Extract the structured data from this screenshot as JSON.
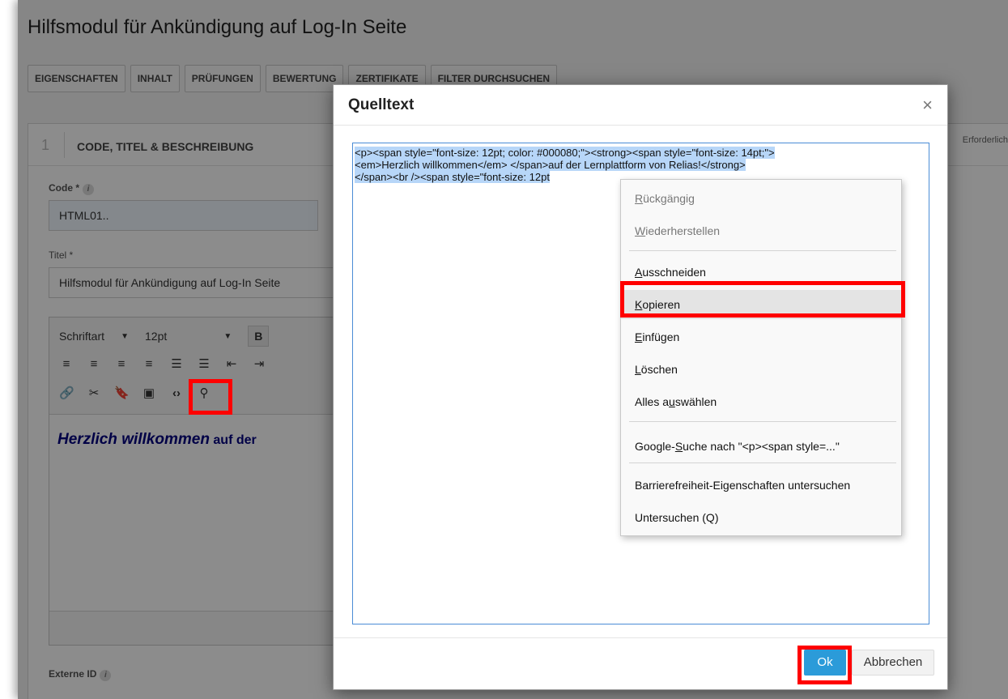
{
  "page": {
    "title": "Hilfsmodul für Ankündigung auf Log-In Seite",
    "tabs": [
      "EIGENSCHAFTEN",
      "INHALT",
      "PRÜFUNGEN",
      "BEWERTUNG",
      "ZERTIFIKATE",
      "FILTER DURCHSUCHEN"
    ],
    "section": {
      "number": "1",
      "title": "CODE, TITEL & BESCHREIBUNG",
      "required_note": "Erforderlich"
    },
    "fields": {
      "code_label": "Code *",
      "code_value": "HTML01..",
      "title_label": "Titel *",
      "title_value": "Hilfsmodul für Ankündigung auf Log-In Seite",
      "external_id_label": "Externe ID"
    },
    "editor": {
      "font_name": "Schriftart",
      "font_size": "12pt",
      "bold_label": "B",
      "content_em": "Herzlich willkommen",
      "content_rest": " auf der"
    }
  },
  "dialog": {
    "title": "Quelltext",
    "close_glyph": "×",
    "source_lines": [
      "<p><span style=\"font-size: 12pt; color: #000080;\"><strong><span style=\"font-size: 14pt;\">",
      "<em>Herzlich willkommen</em> </span>auf der Lernplattform von Relias!</strong>",
      "</span><br /><span style=\"font-size: 12pt"
    ],
    "ok_label": "Ok",
    "cancel_label": "Abbrechen"
  },
  "context_menu": {
    "items": [
      {
        "pre": "",
        "key": "R",
        "post": "ückgängig",
        "disabled": true
      },
      {
        "pre": "",
        "key": "W",
        "post": "iederherstellen",
        "disabled": true
      },
      {
        "pre": "",
        "key": "A",
        "post": "usschneiden",
        "disabled": false
      },
      {
        "pre": "",
        "key": "K",
        "post": "opieren",
        "disabled": false
      },
      {
        "pre": "",
        "key": "E",
        "post": "infügen",
        "disabled": false
      },
      {
        "pre": "",
        "key": "L",
        "post": "öschen",
        "disabled": false
      },
      {
        "pre": "Alles a",
        "key": "u",
        "post": "swählen",
        "disabled": false
      },
      {
        "pre": "Google-",
        "key": "S",
        "post": "uche nach \"<p><span style=...\"",
        "disabled": false
      },
      {
        "pre": "Barrierefreiheit-Eigenschaften untersuchen",
        "key": "",
        "post": "",
        "disabled": false
      },
      {
        "pre": "Untersuchen (Q)",
        "key": "",
        "post": "",
        "disabled": false
      }
    ]
  }
}
